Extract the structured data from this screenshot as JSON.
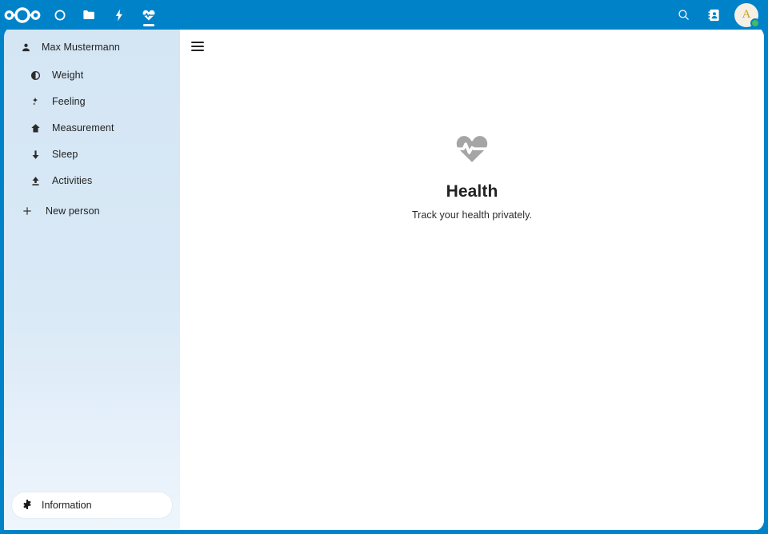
{
  "header": {
    "logo_name": "nextcloud-logo",
    "apps": [
      {
        "name": "dashboard",
        "label": "Dashboard",
        "icon": "circle-icon",
        "active": false
      },
      {
        "name": "files",
        "label": "Files",
        "icon": "folder-icon",
        "active": false
      },
      {
        "name": "activity",
        "label": "Activity",
        "icon": "lightning-bolt-icon",
        "active": false
      },
      {
        "name": "health",
        "label": "Health",
        "icon": "heart-pulse-icon",
        "active": true
      }
    ],
    "search_label": "Search",
    "contacts_label": "Contacts",
    "avatar_initial": "A",
    "avatar_status": "online",
    "accent_color": "#0082c9",
    "status_color": "#46ba61"
  },
  "sidebar": {
    "person": {
      "label": "Max Mustermann",
      "icon": "person-icon"
    },
    "items": [
      {
        "label": "Weight",
        "icon": "weight-icon"
      },
      {
        "label": "Feeling",
        "icon": "feeling-icon"
      },
      {
        "label": "Measurement",
        "icon": "measurement-icon"
      },
      {
        "label": "Sleep",
        "icon": "sleep-icon"
      },
      {
        "label": "Activities",
        "icon": "activities-icon"
      }
    ],
    "new_person": {
      "label": "New person",
      "icon": "plus-icon"
    },
    "footer": {
      "label": "Information",
      "icon": "gear-icon"
    },
    "background_color": "#d6e7f5"
  },
  "main": {
    "menu_toggle_label": "Toggle navigation",
    "empty_state": {
      "icon": "heart-pulse-icon",
      "title": "Health",
      "subtitle": "Track your health privately.",
      "icon_color": "#a5a5a5"
    }
  }
}
